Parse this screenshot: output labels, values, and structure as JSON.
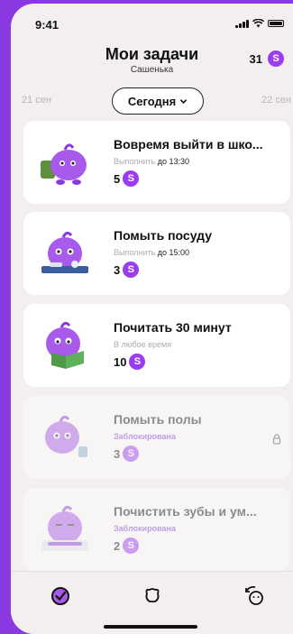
{
  "status": {
    "time": "9:41"
  },
  "header": {
    "title": "Мои задачи",
    "subtitle": "Сашенька",
    "coins": "31",
    "coin_symbol": "S"
  },
  "dates": {
    "prev": "21 сен",
    "current": "Сегодня",
    "next": "22 сен"
  },
  "tasks": [
    {
      "title": "Вовремя выйти в шко...",
      "sub_prefix": "Выполнить",
      "sub_time": "до 13:30",
      "reward": "5",
      "locked": false
    },
    {
      "title": "Помыть посуду",
      "sub_prefix": "Выполнить",
      "sub_time": "до 15:00",
      "reward": "3",
      "locked": false
    },
    {
      "title": "Почитать 30 минут",
      "sub_prefix": "В любое время",
      "sub_time": "",
      "reward": "10",
      "locked": false
    },
    {
      "title": "Помыть полы",
      "status": "Заблокирована",
      "reward": "3",
      "locked": true
    },
    {
      "title": "Почистить зубы и ум...",
      "status": "Заблокирована",
      "reward": "2",
      "locked": true
    }
  ],
  "colors": {
    "accent": "#8a38e0",
    "coin": "#9b3cf0",
    "background": "#f2efee"
  },
  "tabs": [
    {
      "icon": "tasks-check-icon",
      "active": true
    },
    {
      "icon": "pet-icon",
      "active": false
    },
    {
      "icon": "rewards-refresh-icon",
      "active": false
    }
  ]
}
